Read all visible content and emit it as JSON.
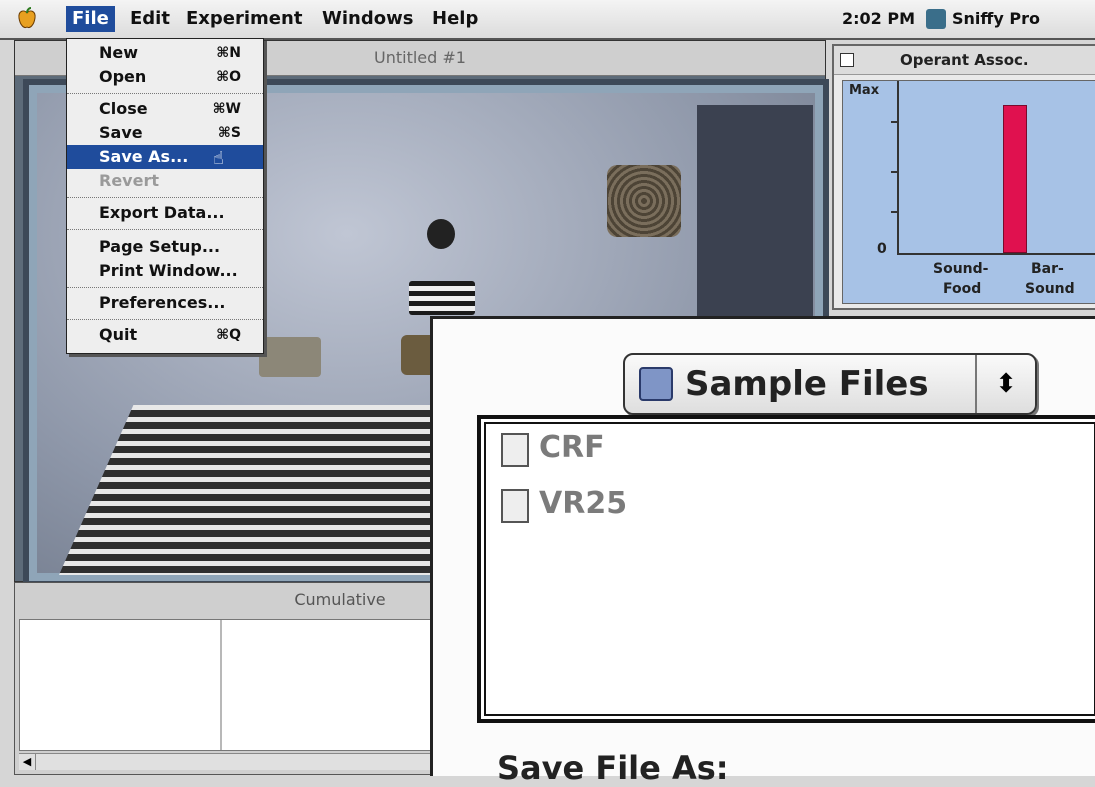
{
  "menubar": {
    "items": [
      "File",
      "Edit",
      "Experiment",
      "Windows",
      "Help"
    ],
    "clock": "2:02 PM",
    "app_name": "Sniffy Pro"
  },
  "main_window": {
    "title": "Untitled #1"
  },
  "file_menu": {
    "items": [
      {
        "label": "New",
        "shortcut": "⌘N",
        "state": "normal"
      },
      {
        "label": "Open",
        "shortcut": "⌘O",
        "state": "normal"
      },
      {
        "label": "Close",
        "shortcut": "⌘W",
        "state": "normal"
      },
      {
        "label": "Save",
        "shortcut": "⌘S",
        "state": "normal"
      },
      {
        "label": "Save As...",
        "shortcut": "",
        "state": "highlighted"
      },
      {
        "label": "Revert",
        "shortcut": "",
        "state": "disabled"
      },
      {
        "label": "Export Data...",
        "shortcut": "",
        "state": "normal"
      },
      {
        "label": "Page Setup...",
        "shortcut": "",
        "state": "normal"
      },
      {
        "label": "Print Window...",
        "shortcut": "",
        "state": "normal"
      },
      {
        "label": "Preferences...",
        "shortcut": "",
        "state": "normal"
      },
      {
        "label": "Quit",
        "shortcut": "⌘Q",
        "state": "normal"
      }
    ]
  },
  "operant_window": {
    "title": "Operant Assoc.",
    "y_max_label": "Max",
    "y_zero_label": "0",
    "categories": [
      {
        "line1": "Sound-",
        "line2": "Food"
      },
      {
        "line1": "Bar-",
        "line2": "Sound"
      }
    ],
    "bar_color": "#e0114f"
  },
  "chart_data": {
    "type": "bar",
    "categories": [
      "Sound-Food",
      "Bar-Sound"
    ],
    "values": [
      0.9,
      0
    ],
    "ylabel": "",
    "ylim": [
      0,
      1
    ],
    "y_tick_labels": [
      "0",
      "Max"
    ]
  },
  "cumulative_window": {
    "title": "Cumulative"
  },
  "save_dialog": {
    "folder": "Sample Files",
    "files": [
      "CRF",
      "VR25"
    ],
    "save_as_label": "Save File As:"
  },
  "colors": {
    "menu_highlight": "#1f4c9c",
    "plot_background": "#a7c2e6"
  }
}
